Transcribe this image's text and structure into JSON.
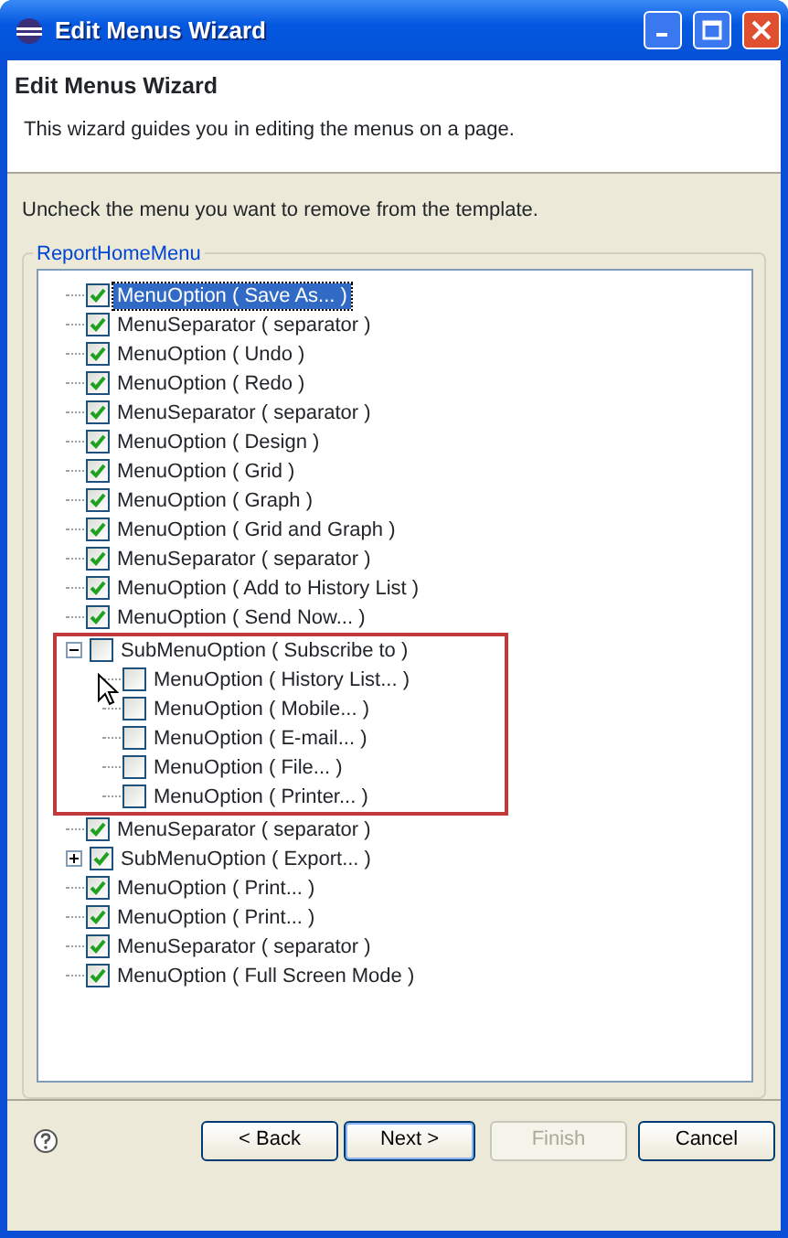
{
  "window": {
    "title": "Edit Menus Wizard"
  },
  "header": {
    "title": "Edit Menus Wizard",
    "description": "This wizard guides you in editing the menus on a page."
  },
  "instruction": "Uncheck the menu you want to remove from the template.",
  "group": {
    "label": "ReportHomeMenu"
  },
  "tree": [
    {
      "label": "MenuOption ( Save As... )",
      "checked": true,
      "selected": true
    },
    {
      "label": "MenuSeparator ( separator )",
      "checked": true,
      "selected": false
    },
    {
      "label": "MenuOption ( Undo )",
      "checked": true,
      "selected": false
    },
    {
      "label": "MenuOption ( Redo )",
      "checked": true,
      "selected": false
    },
    {
      "label": "MenuSeparator ( separator )",
      "checked": true,
      "selected": false
    },
    {
      "label": "MenuOption ( Design )",
      "checked": true,
      "selected": false
    },
    {
      "label": "MenuOption ( Grid )",
      "checked": true,
      "selected": false
    },
    {
      "label": "MenuOption ( Graph )",
      "checked": true,
      "selected": false
    },
    {
      "label": "MenuOption ( Grid and Graph )",
      "checked": true,
      "selected": false
    },
    {
      "label": "MenuSeparator ( separator )",
      "checked": true,
      "selected": false
    },
    {
      "label": "MenuOption ( Add to History List )",
      "checked": true,
      "selected": false
    },
    {
      "label": "MenuOption ( Send Now... )",
      "checked": true,
      "selected": false
    },
    {
      "label": "SubMenuOption ( Subscribe to )",
      "checked": false,
      "selected": false,
      "expanded": true,
      "highlighted": true,
      "children": [
        {
          "label": "MenuOption ( History List... )",
          "checked": false,
          "selected": false
        },
        {
          "label": "MenuOption ( Mobile... )",
          "checked": false,
          "selected": false
        },
        {
          "label": "MenuOption ( E-mail... )",
          "checked": false,
          "selected": false
        },
        {
          "label": "MenuOption ( File... )",
          "checked": false,
          "selected": false
        },
        {
          "label": "MenuOption ( Printer... )",
          "checked": false,
          "selected": false
        }
      ]
    },
    {
      "label": "MenuSeparator ( separator )",
      "checked": true,
      "selected": false
    },
    {
      "label": "SubMenuOption ( Export... )",
      "checked": true,
      "selected": false,
      "expanded": false
    },
    {
      "label": "MenuOption ( Print... )",
      "checked": true,
      "selected": false
    },
    {
      "label": "MenuOption ( Print... )",
      "checked": true,
      "selected": false
    },
    {
      "label": "MenuSeparator ( separator )",
      "checked": true,
      "selected": false
    },
    {
      "label": "MenuOption ( Full Screen Mode )",
      "checked": true,
      "selected": false
    }
  ],
  "buttons": [
    {
      "label": "< Back",
      "disabled": false,
      "default": false
    },
    {
      "label": "Next >",
      "disabled": false,
      "default": true
    },
    {
      "label": "Finish",
      "disabled": true,
      "default": false
    },
    {
      "label": "Cancel",
      "disabled": false,
      "default": false
    }
  ]
}
